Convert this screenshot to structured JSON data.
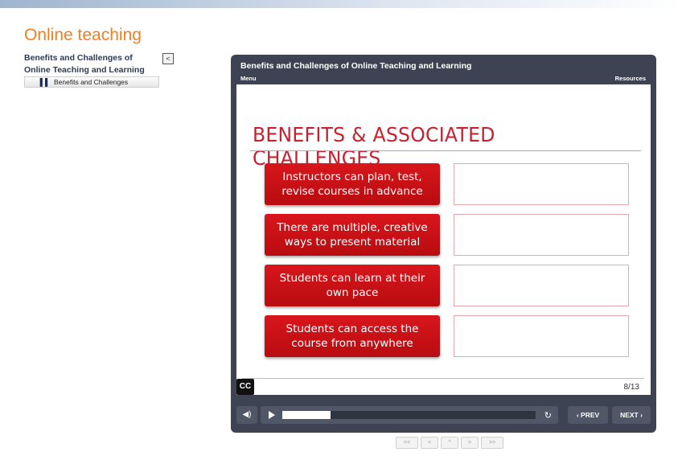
{
  "app": {
    "title": "Online teaching"
  },
  "outline": {
    "title": "Benefits and Challenges of Online Teaching and Learning",
    "collapse_label": "<",
    "items": [
      {
        "icon": "bars-icon",
        "label": "Benefits and Challenges"
      }
    ]
  },
  "player": {
    "title": "Benefits and Challenges of Online Teaching and Learning",
    "menu_label": "Menu",
    "resources_label": "Resources",
    "slide": {
      "heading": "BENEFITS & ASSOCIATED CHALLENGES",
      "rows": [
        {
          "benefit": "Instructors can plan, test, revise courses in advance",
          "challenge": ""
        },
        {
          "benefit": "There are multiple, creative ways to present material",
          "challenge": ""
        },
        {
          "benefit": "Students can learn at their own pace",
          "challenge": ""
        },
        {
          "benefit": "Students can access the course from anywhere",
          "challenge": ""
        }
      ],
      "cc_label": "CC",
      "counter": "8/13"
    },
    "controls": {
      "prev_label": "‹ PREV",
      "next_label": "NEXT ›",
      "progress": 0.19
    }
  },
  "pager": {
    "buttons": [
      "<<",
      "<",
      "^",
      ">",
      ">>"
    ]
  },
  "colors": {
    "title_orange": "#f07f22",
    "benefit_red": "#c8141a",
    "player_dark": "#3d4352",
    "heading_red": "#c8202f"
  }
}
